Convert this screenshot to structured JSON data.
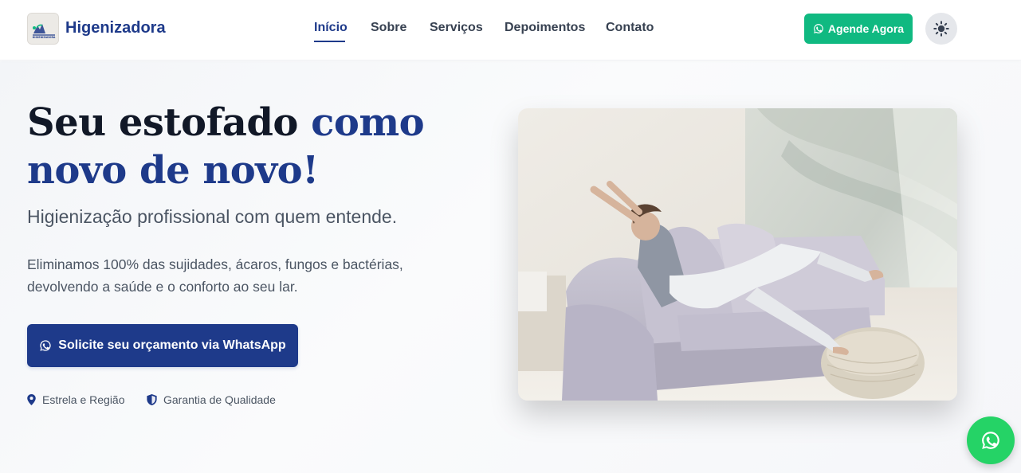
{
  "header": {
    "brand": "Higenizadora",
    "logo_text": "HIGIENIZADORA",
    "nav": [
      {
        "label": "Início"
      },
      {
        "label": "Sobre"
      },
      {
        "label": "Serviços"
      },
      {
        "label": "Depoimentos"
      },
      {
        "label": "Contato"
      }
    ],
    "active_nav": "Início",
    "cta_label": "Agende Agora",
    "theme_toggle_icon": "sun-icon"
  },
  "hero": {
    "title_part1": "Seu estofado ",
    "title_accent": "como novo de novo!",
    "subtitle": "Higienização profissional com quem entende.",
    "description": "Eliminamos 100% das sujidades, ácaros, fungos e bactérias, devolvendo a saúde e o conforto ao seu lar.",
    "cta_label": "Solicite seu orçamento via WhatsApp",
    "badges": [
      {
        "icon": "map-pin-icon",
        "label": "Estrela e Região"
      },
      {
        "icon": "shield-icon",
        "label": "Garantia de Qualidade"
      }
    ]
  },
  "floating": {
    "icon": "whatsapp-icon"
  },
  "colors": {
    "primary": "#1e3a8a",
    "green_cta": "#10b981",
    "whatsapp": "#25d366",
    "text_dark": "#111827",
    "text_muted": "#4b5563"
  }
}
